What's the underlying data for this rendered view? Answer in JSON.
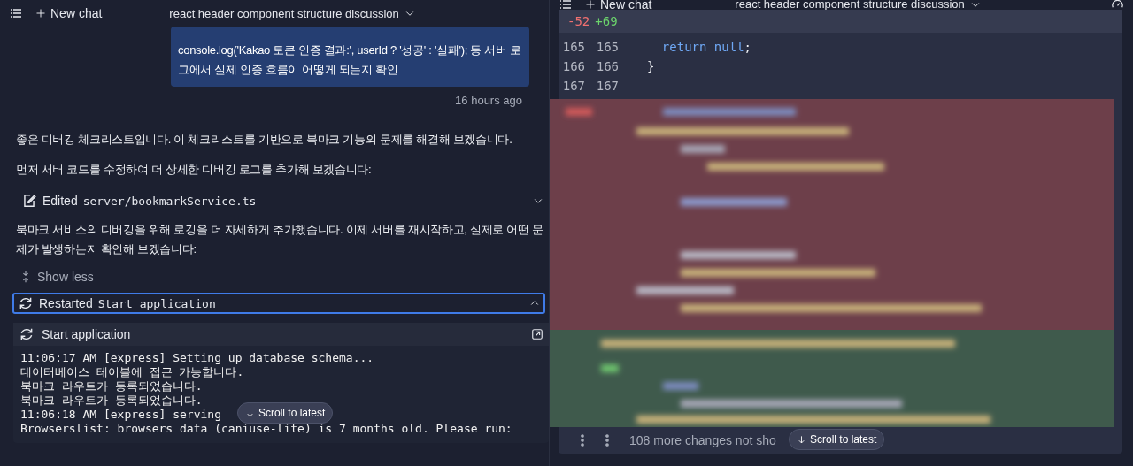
{
  "left": {
    "header": {
      "new_chat": "New chat",
      "title": "react header component structure discussion"
    },
    "user_message": {
      "text": "console.log('Kakao 토큰 인증 결과:', userId ? '성공' : '실패'); 등 서버 로그에서 실제 인증 흐름이 어떻게 되는지 확인",
      "time": "16 hours ago"
    },
    "items": [
      {
        "kind": "paragraph",
        "text": "좋은 디버깅 체크리스트입니다. 이 체크리스트를 기반으로 북마크 기능의 문제를 해결해 보겠습니다."
      },
      {
        "kind": "paragraph",
        "text": "먼저 서버 코드를 수정하여 더 상세한 디버깅 로그를 추가해 보겠습니다:"
      },
      {
        "kind": "edit",
        "label": "Edited",
        "file": "server/bookmarkService.ts",
        "expanded": false,
        "focused": false
      },
      {
        "kind": "paragraph",
        "text": "북마크 서비스의 디버깅을 위해 로깅을 더 자세하게 추가했습니다. 이제 서버를 재시작하고, 실제로 어떤 문제가 발생하는지 확인해 보겠습니다:"
      },
      {
        "kind": "toggle",
        "label": "Show less"
      },
      {
        "kind": "restart",
        "label": "Restarted",
        "target": "Start  application",
        "expanded": true,
        "focused": true
      }
    ],
    "console": {
      "title": "Start application",
      "lines": [
        "11:06:17 AM [express] Setting up database schema...",
        "데이터베이스 테이블에 접근 가능합니다.",
        "북마크 라우트가 등록되었습니다.",
        "북마크 라우트가 등록되었습니다.",
        "11:06:18 AM [express] serving",
        "Browserslist: browsers data (caniuse-lite) is 7 months old. Please run:"
      ]
    },
    "scroll_button": "Scroll to latest"
  },
  "right": {
    "header": {
      "new_chat": "New chat",
      "title": "react header component structure discussion"
    },
    "diff": {
      "removed": "-52",
      "added": "+69",
      "lines": [
        {
          "old": "165",
          "new": "165",
          "tokens": [
            {
              "text": "  return null",
              "kind": "keyword"
            },
            {
              "text": ";",
              "kind": "plain"
            }
          ]
        },
        {
          "old": "166",
          "new": "166",
          "tokens": [
            {
              "text": "}",
              "kind": "plain"
            }
          ]
        },
        {
          "old": "167",
          "new": "167"
        }
      ],
      "more": "108 more changes not sho"
    },
    "scroll_button": "Scroll to latest"
  }
}
